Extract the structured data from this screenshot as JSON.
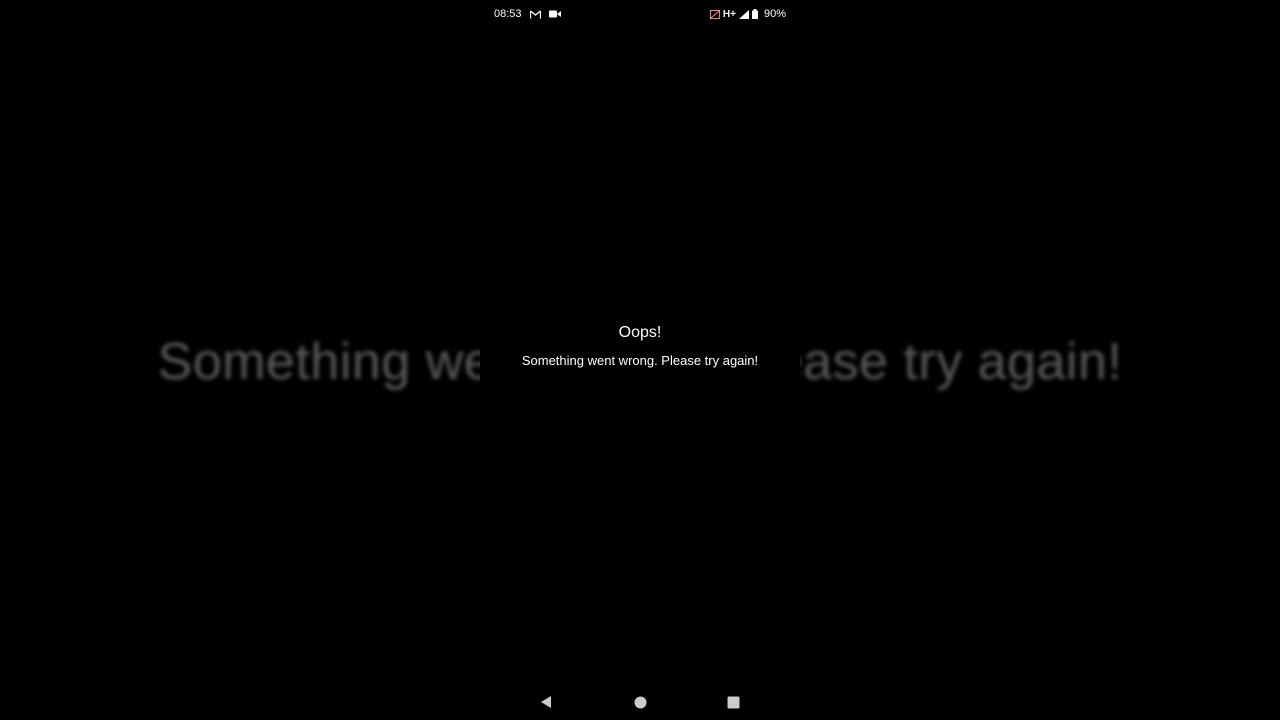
{
  "status_bar": {
    "time": "08:53",
    "left_icons": [
      "gmail-icon",
      "video-camera-icon"
    ],
    "network_type": "H+",
    "battery_percent": "90%",
    "right_icons": [
      "mute-icon",
      "signal-icon",
      "battery-icon"
    ]
  },
  "error": {
    "title": "Oops!",
    "message": "Something went wrong. Please try again!"
  },
  "navigation_bar": {
    "buttons": [
      "back-icon",
      "home-icon",
      "recents-icon"
    ]
  },
  "colors": {
    "background": "#000000",
    "text": "#ffffff",
    "blurred_text": "#6a6a6a"
  }
}
